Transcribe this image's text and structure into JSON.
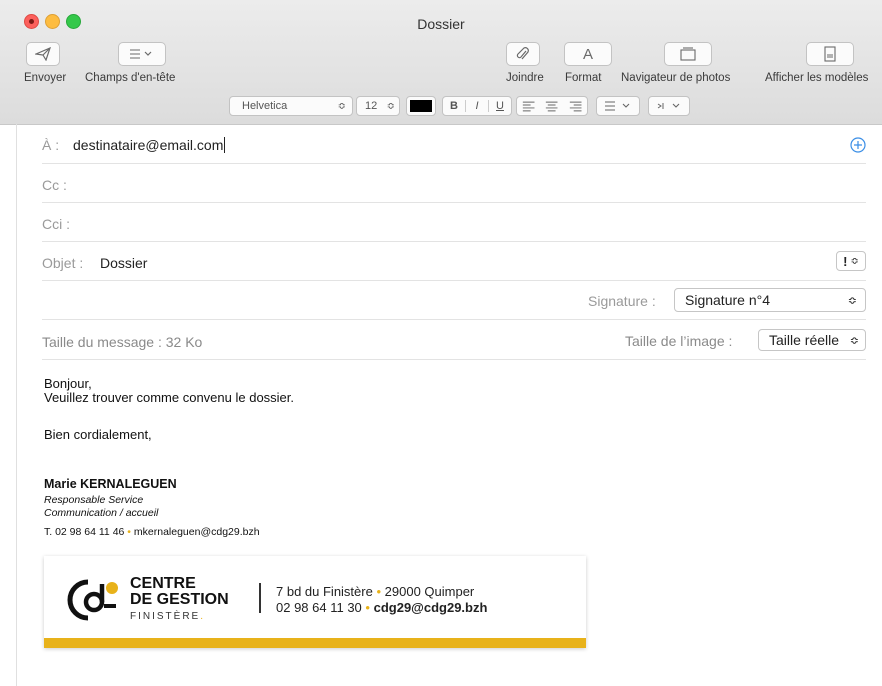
{
  "window": {
    "title": "Dossier"
  },
  "toolbar": {
    "send_label": "Envoyer",
    "header_fields_label": "Champs d'en-tête",
    "attach_label": "Joindre",
    "format_label": "Format",
    "format_glyph": "A",
    "photo_browser_label": "Navigateur de photos",
    "templates_label": "Afficher les modèles"
  },
  "format_bar": {
    "font": "Helvetica",
    "size": "12",
    "text_color": "#000000",
    "bold": "B",
    "italic": "I",
    "underline": "U"
  },
  "header": {
    "to_label": "À :",
    "to_value": "destinataire@email.com",
    "cc_label": "Cc :",
    "bcc_label": "Cci :",
    "subject_label": "Objet :",
    "subject_value": "Dossier",
    "priority_glyph": "!",
    "signature_label": "Signature :",
    "signature_value": "Signature n°4",
    "message_size_label": "Taille du message : 32 Ko",
    "image_size_label": "Taille de l’image :",
    "image_size_value": "Taille réelle"
  },
  "body": {
    "greeting": "Bonjour,",
    "line1": "Veuillez trouver comme convenu le dossier.",
    "closing": "Bien cordialement,",
    "sig_name": "Marie KERNALEGUEN",
    "sig_role1": "Responsable Service",
    "sig_role2": "Communication / accueil",
    "sig_phone": "T. 02 98 64 11 46",
    "sig_email": "mkernaleguen@cdg29.bzh",
    "bullet": "•"
  },
  "banner": {
    "org_line1": "CENTRE",
    "org_line2": "DE GESTION",
    "org_line3": "FINISTÈRE",
    "address_street": "7 bd du Finistère",
    "address_city": "29000 Quimper",
    "phone": "02 98 64 11 30",
    "email": "cdg29@cdg29.bzh",
    "bullet": "•"
  },
  "colors": {
    "accent": "#e8b21a",
    "link_blue": "#3a8ee6"
  }
}
